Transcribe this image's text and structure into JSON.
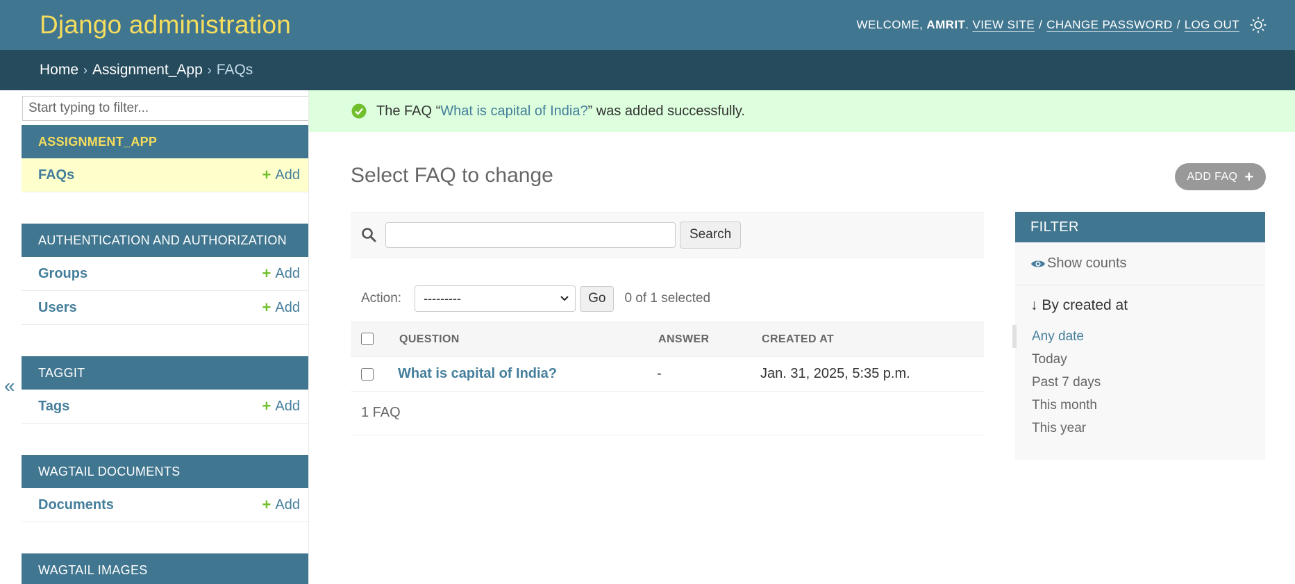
{
  "header": {
    "site_name": "Django administration",
    "welcome": "WELCOME,",
    "username": "AMRIT",
    "period": ".",
    "view_site": "VIEW SITE",
    "change_password": "CHANGE PASSWORD",
    "log_out": "LOG OUT",
    "separator": "/",
    "theme_icon": "sun-icon"
  },
  "breadcrumbs": {
    "home": "Home",
    "app": "Assignment_App",
    "current": "FAQs",
    "separator": "›"
  },
  "sidebar": {
    "filter_placeholder": "Start typing to filter...",
    "toggle": "«",
    "add_label": "Add",
    "modules": [
      {
        "caption": "ASSIGNMENT_APP",
        "models": [
          "FAQs"
        ]
      },
      {
        "caption": "AUTHENTICATION AND AUTHORIZATION",
        "models": [
          "Groups",
          "Users"
        ]
      },
      {
        "caption": "TAGGIT",
        "models": [
          "Tags"
        ]
      },
      {
        "caption": "WAGTAIL DOCUMENTS",
        "models": [
          "Documents"
        ]
      },
      {
        "caption": "WAGTAIL IMAGES",
        "models": []
      }
    ]
  },
  "message": {
    "prefix": "The FAQ “",
    "link": "What is capital of India?",
    "suffix": "” was added successfully.",
    "color": "#ddffdd"
  },
  "content": {
    "title": "Select FAQ to change",
    "add_button": "ADD FAQ",
    "search_button": "Search",
    "action_label": "Action:",
    "action_selected": "---------",
    "go_button": "Go",
    "counter": "0 of 1 selected",
    "columns": [
      "QUESTION",
      "ANSWER",
      "CREATED AT"
    ],
    "rows": [
      {
        "question": "What is capital of India?",
        "answer": "-",
        "created_at": "Jan. 31, 2025, 5:35 p.m."
      }
    ],
    "paginator": "1 FAQ"
  },
  "filter": {
    "title": "FILTER",
    "show_counts": "Show counts",
    "heading": "↓ By created at",
    "options": [
      "Any date",
      "Today",
      "Past 7 days",
      "This month",
      "This year"
    ],
    "selected": "Any date"
  },
  "colors": {
    "primary": "#417690",
    "secondary": "#264b5d",
    "accent": "#f5dd5d",
    "link": "#447e9b",
    "success": "#70bf2b"
  }
}
